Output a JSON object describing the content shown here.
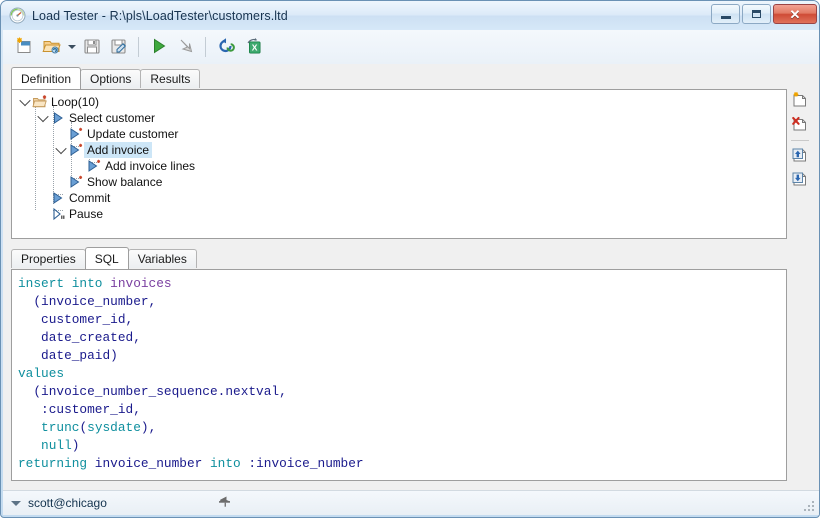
{
  "window": {
    "title": "Load Tester - R:\\pls\\LoadTester\\customers.ltd",
    "icon": "gauge-icon",
    "controls": {
      "minimize": "–",
      "maximize": "□",
      "close": "✕"
    }
  },
  "toolbar": {
    "buttons": [
      {
        "name": "new-file-icon",
        "title": "New"
      },
      {
        "name": "open-file-icon",
        "title": "Open"
      },
      {
        "name": "open-dropdown-caret",
        "title": "Open recent"
      },
      {
        "name": "save-icon",
        "title": "Save"
      },
      {
        "name": "save-as-icon",
        "title": "Save As"
      },
      {
        "name": "run-icon",
        "title": "Run"
      },
      {
        "name": "stop-icon",
        "title": "Stop"
      },
      {
        "name": "refresh-icon",
        "title": "Refresh"
      },
      {
        "name": "export-excel-icon",
        "title": "Export to Excel"
      }
    ]
  },
  "main_tabs": [
    {
      "label": "Definition",
      "active": true
    },
    {
      "label": "Options",
      "active": false
    },
    {
      "label": "Results",
      "active": false
    }
  ],
  "tree": {
    "nodes": [
      {
        "label": "Loop(10)",
        "depth": 0,
        "icon": "folder-star-icon",
        "expander": "expanded",
        "selected": false
      },
      {
        "label": "Select customer",
        "depth": 1,
        "icon": "statement-icon",
        "expander": "expanded",
        "selected": false
      },
      {
        "label": "Update customer",
        "depth": 2,
        "icon": "statement-star-icon",
        "expander": "none",
        "selected": false
      },
      {
        "label": "Add invoice",
        "depth": 2,
        "icon": "statement-star-icon",
        "expander": "expanded",
        "selected": true
      },
      {
        "label": "Add invoice lines",
        "depth": 3,
        "icon": "statement-star-icon",
        "expander": "none",
        "selected": false
      },
      {
        "label": "Show balance",
        "depth": 2,
        "icon": "statement-star-icon",
        "expander": "none",
        "selected": false
      },
      {
        "label": "Commit",
        "depth": 1,
        "icon": "statement-icon",
        "expander": "none",
        "selected": false
      },
      {
        "label": "Pause",
        "depth": 1,
        "icon": "pause-statement-icon",
        "expander": "none",
        "selected": false
      }
    ]
  },
  "tree_side_buttons": [
    {
      "name": "add-node-icon",
      "title": "Add"
    },
    {
      "name": "delete-node-icon",
      "title": "Delete"
    },
    {
      "name": "move-up-icon",
      "title": "Move up"
    },
    {
      "name": "move-down-icon",
      "title": "Move down"
    }
  ],
  "lower_tabs": [
    {
      "label": "Properties",
      "active": false
    },
    {
      "label": "SQL",
      "active": true
    },
    {
      "label": "Variables",
      "active": false
    }
  ],
  "sql_editor": {
    "lines": [
      [
        {
          "t": "insert into ",
          "c": "k"
        },
        {
          "t": "invoices",
          "c": "tbl"
        }
      ],
      [
        {
          "t": "  (invoice_number,",
          "c": "id"
        }
      ],
      [
        {
          "t": "   customer_id,",
          "c": "id"
        }
      ],
      [
        {
          "t": "   date_created,",
          "c": "id"
        }
      ],
      [
        {
          "t": "   date_paid)",
          "c": "id"
        }
      ],
      [
        {
          "t": "values",
          "c": "k"
        }
      ],
      [
        {
          "t": "  (invoice_number_sequence.nextval,",
          "c": "id"
        }
      ],
      [
        {
          "t": "   :customer_id,",
          "c": "id"
        }
      ],
      [
        {
          "t": "   ",
          "c": "id"
        },
        {
          "t": "trunc",
          "c": "k"
        },
        {
          "t": "(",
          "c": "id"
        },
        {
          "t": "sysdate",
          "c": "k"
        },
        {
          "t": "),",
          "c": "id"
        }
      ],
      [
        {
          "t": "   ",
          "c": "id"
        },
        {
          "t": "null",
          "c": "k"
        },
        {
          "t": ")",
          "c": "id"
        }
      ],
      [
        {
          "t": "returning ",
          "c": "k"
        },
        {
          "t": "invoice_number ",
          "c": "id"
        },
        {
          "t": "into ",
          "c": "k"
        },
        {
          "t": ":invoice_number",
          "c": "id"
        }
      ]
    ],
    "plain_text": "insert into invoices\n  (invoice_number,\n   customer_id,\n   date_created,\n   date_paid)\nvalues\n  (invoice_number_sequence.nextval,\n   :customer_id,\n   trunc(sysdate),\n   null)\nreturning invoice_number into :invoice_number"
  },
  "status_bar": {
    "connection": "scott@chicago",
    "dropdown_icon": "chevron-down-icon",
    "pin_icon": "pin-icon"
  },
  "colors": {
    "keyword": "#0f8f9e",
    "identifier": "#1a1a8c",
    "table": "#7a3fa0",
    "selection": "#cde6f7",
    "window_border": "#6a91b4",
    "close_button": "#cf4b36"
  }
}
